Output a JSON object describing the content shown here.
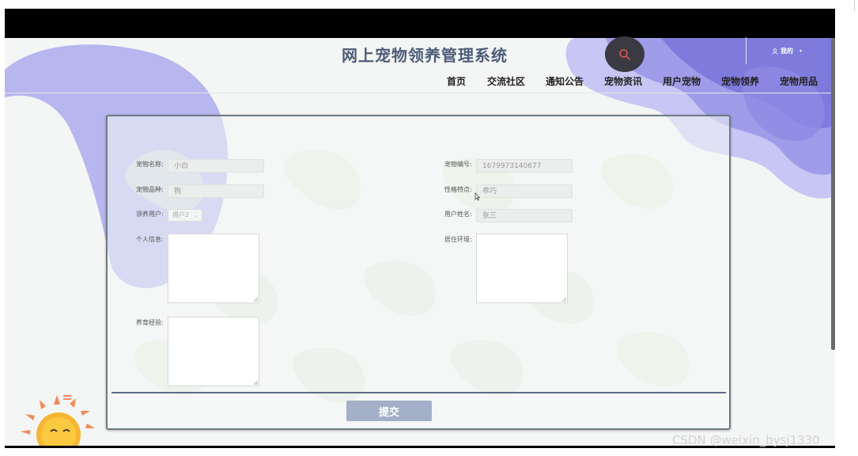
{
  "site": {
    "title": "网上宠物领养管理系统"
  },
  "nav": {
    "items": [
      {
        "label": "首页"
      },
      {
        "label": "交流社区"
      },
      {
        "label": "通知公告"
      },
      {
        "label": "宠物资讯"
      },
      {
        "label": "用户宠物"
      },
      {
        "label": "宠物领养"
      },
      {
        "label": "宠物用品"
      }
    ]
  },
  "header": {
    "search_icon": "search-icon",
    "user_label": "我的",
    "user_icon": "user-icon"
  },
  "form": {
    "pet_name": {
      "label": "宠物名称:",
      "value": "小白"
    },
    "pet_no": {
      "label": "宠物编号:",
      "value": "1679973140677"
    },
    "pet_breed": {
      "label": "宠物品种:",
      "value": "狗"
    },
    "traits": {
      "label": "性格特点:",
      "value": "乖巧"
    },
    "adopt_user": {
      "label": "领养用户:",
      "value": "用户2"
    },
    "user_name": {
      "label": "用户姓名:",
      "value": "张三"
    },
    "personal_info": {
      "label": "个人信息:",
      "value": ""
    },
    "living_env": {
      "label": "居住环境:",
      "value": ""
    },
    "experience": {
      "label": "养育经验:",
      "value": ""
    },
    "submit_label": "提交"
  },
  "watermark": "CSDN @weixin_bysj1330",
  "colors": {
    "accent": "#a3b0c8",
    "blob_purple": "#9c9ce8",
    "title": "#4d5c78"
  }
}
